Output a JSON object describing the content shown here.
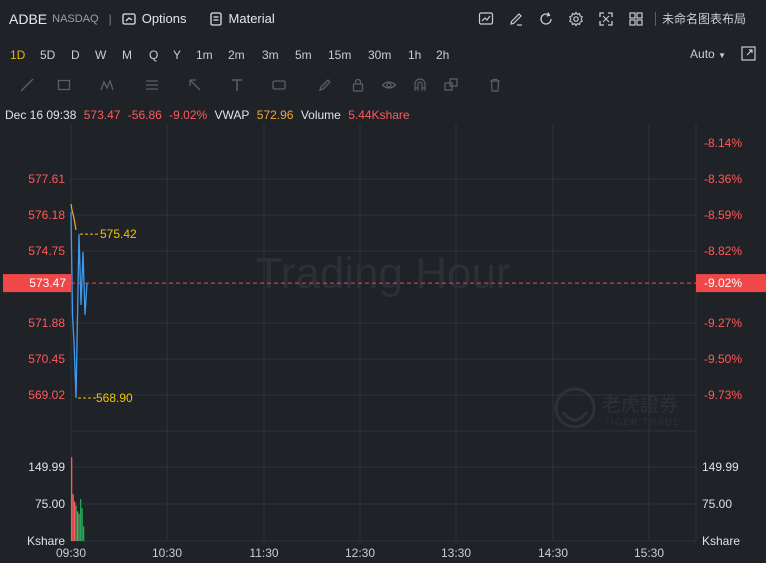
{
  "toolbar": {
    "symbol": "ADBE",
    "exchange": "NASDAQ",
    "separator": "|",
    "options_label": "Options",
    "material_label": "Material",
    "layout_name": "未命名图表布局"
  },
  "periods": [
    "1D",
    "5D",
    "D",
    "W",
    "M",
    "Q",
    "Y",
    "1m",
    "2m",
    "3m",
    "5m",
    "15m",
    "30m",
    "1h",
    "2h"
  ],
  "active_period": "1D",
  "scale_mode": "Auto",
  "info_bar": {
    "datetime": "Dec 16 09:38",
    "price": "573.47",
    "change": "-56.86",
    "change_pct": "-9.02%",
    "vwap_label": "VWAP",
    "vwap": "572.96",
    "volume_label": "Volume",
    "volume": "5.44Kshare"
  },
  "watermark": "Trading Hour",
  "logo": {
    "cn": "老虎證券",
    "en": "TIGER TRADE"
  },
  "price_axis_left": [
    "577.61",
    "576.18",
    "574.75",
    "573.47",
    "571.88",
    "570.45",
    "569.02"
  ],
  "price_axis_right": [
    "-8.14%",
    "-8.36%",
    "-8.59%",
    "-8.82%",
    "-9.02%",
    "-9.27%",
    "-9.50%",
    "-9.73%"
  ],
  "volume_axis": [
    "149.99",
    "75.00",
    "Kshare"
  ],
  "time_axis": [
    "09:30",
    "10:30",
    "11:30",
    "12:30",
    "13:30",
    "14:30",
    "15:30"
  ],
  "annotations": {
    "high": "575.42",
    "low": "568.90"
  },
  "colors": {
    "up": "#ff5a5a",
    "down": "#26a65b",
    "line": "#3d9cf0",
    "accent": "#f0b400",
    "last_price_bg": "#f04848"
  },
  "chart_data": {
    "type": "line",
    "title": "",
    "x": [
      "09:30",
      "09:31",
      "09:32",
      "09:33",
      "09:34",
      "09:35",
      "09:36",
      "09:37",
      "09:38"
    ],
    "price": [
      576.3,
      572.2,
      571.1,
      568.9,
      575.42,
      572.6,
      574.7,
      572.2,
      573.47
    ],
    "ylim": [
      568.1,
      578.4
    ],
    "volume": [
      170,
      95,
      80,
      72,
      60,
      55,
      85,
      66,
      30
    ],
    "volume_colors": [
      "up",
      "up",
      "up",
      "down",
      "up",
      "down",
      "down",
      "down",
      "down"
    ],
    "last_price": 573.47
  }
}
